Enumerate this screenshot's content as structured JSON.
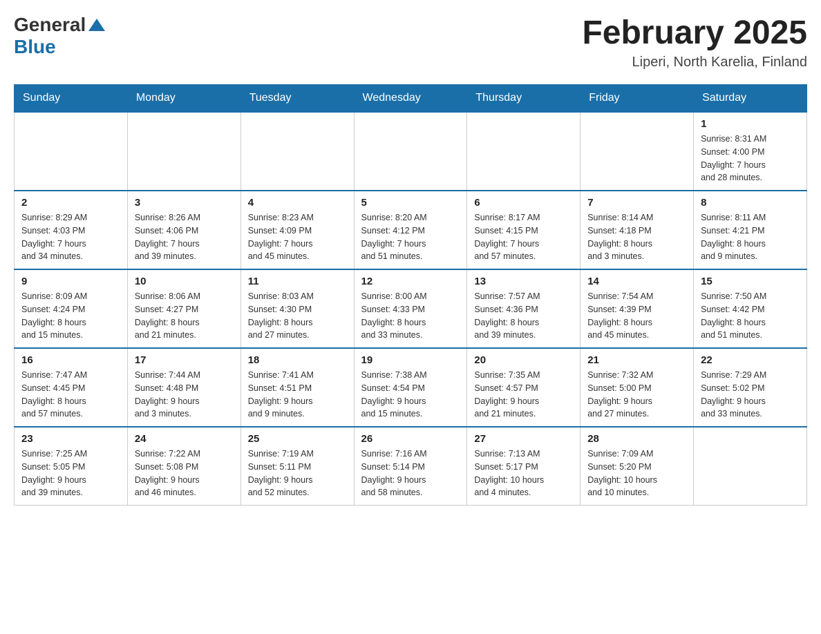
{
  "header": {
    "logo_general": "General",
    "logo_blue": "Blue",
    "title": "February 2025",
    "location": "Liperi, North Karelia, Finland"
  },
  "weekdays": [
    "Sunday",
    "Monday",
    "Tuesday",
    "Wednesday",
    "Thursday",
    "Friday",
    "Saturday"
  ],
  "weeks": [
    [
      {
        "day": "",
        "info": ""
      },
      {
        "day": "",
        "info": ""
      },
      {
        "day": "",
        "info": ""
      },
      {
        "day": "",
        "info": ""
      },
      {
        "day": "",
        "info": ""
      },
      {
        "day": "",
        "info": ""
      },
      {
        "day": "1",
        "info": "Sunrise: 8:31 AM\nSunset: 4:00 PM\nDaylight: 7 hours\nand 28 minutes."
      }
    ],
    [
      {
        "day": "2",
        "info": "Sunrise: 8:29 AM\nSunset: 4:03 PM\nDaylight: 7 hours\nand 34 minutes."
      },
      {
        "day": "3",
        "info": "Sunrise: 8:26 AM\nSunset: 4:06 PM\nDaylight: 7 hours\nand 39 minutes."
      },
      {
        "day": "4",
        "info": "Sunrise: 8:23 AM\nSunset: 4:09 PM\nDaylight: 7 hours\nand 45 minutes."
      },
      {
        "day": "5",
        "info": "Sunrise: 8:20 AM\nSunset: 4:12 PM\nDaylight: 7 hours\nand 51 minutes."
      },
      {
        "day": "6",
        "info": "Sunrise: 8:17 AM\nSunset: 4:15 PM\nDaylight: 7 hours\nand 57 minutes."
      },
      {
        "day": "7",
        "info": "Sunrise: 8:14 AM\nSunset: 4:18 PM\nDaylight: 8 hours\nand 3 minutes."
      },
      {
        "day": "8",
        "info": "Sunrise: 8:11 AM\nSunset: 4:21 PM\nDaylight: 8 hours\nand 9 minutes."
      }
    ],
    [
      {
        "day": "9",
        "info": "Sunrise: 8:09 AM\nSunset: 4:24 PM\nDaylight: 8 hours\nand 15 minutes."
      },
      {
        "day": "10",
        "info": "Sunrise: 8:06 AM\nSunset: 4:27 PM\nDaylight: 8 hours\nand 21 minutes."
      },
      {
        "day": "11",
        "info": "Sunrise: 8:03 AM\nSunset: 4:30 PM\nDaylight: 8 hours\nand 27 minutes."
      },
      {
        "day": "12",
        "info": "Sunrise: 8:00 AM\nSunset: 4:33 PM\nDaylight: 8 hours\nand 33 minutes."
      },
      {
        "day": "13",
        "info": "Sunrise: 7:57 AM\nSunset: 4:36 PM\nDaylight: 8 hours\nand 39 minutes."
      },
      {
        "day": "14",
        "info": "Sunrise: 7:54 AM\nSunset: 4:39 PM\nDaylight: 8 hours\nand 45 minutes."
      },
      {
        "day": "15",
        "info": "Sunrise: 7:50 AM\nSunset: 4:42 PM\nDaylight: 8 hours\nand 51 minutes."
      }
    ],
    [
      {
        "day": "16",
        "info": "Sunrise: 7:47 AM\nSunset: 4:45 PM\nDaylight: 8 hours\nand 57 minutes."
      },
      {
        "day": "17",
        "info": "Sunrise: 7:44 AM\nSunset: 4:48 PM\nDaylight: 9 hours\nand 3 minutes."
      },
      {
        "day": "18",
        "info": "Sunrise: 7:41 AM\nSunset: 4:51 PM\nDaylight: 9 hours\nand 9 minutes."
      },
      {
        "day": "19",
        "info": "Sunrise: 7:38 AM\nSunset: 4:54 PM\nDaylight: 9 hours\nand 15 minutes."
      },
      {
        "day": "20",
        "info": "Sunrise: 7:35 AM\nSunset: 4:57 PM\nDaylight: 9 hours\nand 21 minutes."
      },
      {
        "day": "21",
        "info": "Sunrise: 7:32 AM\nSunset: 5:00 PM\nDaylight: 9 hours\nand 27 minutes."
      },
      {
        "day": "22",
        "info": "Sunrise: 7:29 AM\nSunset: 5:02 PM\nDaylight: 9 hours\nand 33 minutes."
      }
    ],
    [
      {
        "day": "23",
        "info": "Sunrise: 7:25 AM\nSunset: 5:05 PM\nDaylight: 9 hours\nand 39 minutes."
      },
      {
        "day": "24",
        "info": "Sunrise: 7:22 AM\nSunset: 5:08 PM\nDaylight: 9 hours\nand 46 minutes."
      },
      {
        "day": "25",
        "info": "Sunrise: 7:19 AM\nSunset: 5:11 PM\nDaylight: 9 hours\nand 52 minutes."
      },
      {
        "day": "26",
        "info": "Sunrise: 7:16 AM\nSunset: 5:14 PM\nDaylight: 9 hours\nand 58 minutes."
      },
      {
        "day": "27",
        "info": "Sunrise: 7:13 AM\nSunset: 5:17 PM\nDaylight: 10 hours\nand 4 minutes."
      },
      {
        "day": "28",
        "info": "Sunrise: 7:09 AM\nSunset: 5:20 PM\nDaylight: 10 hours\nand 10 minutes."
      },
      {
        "day": "",
        "info": ""
      }
    ]
  ]
}
